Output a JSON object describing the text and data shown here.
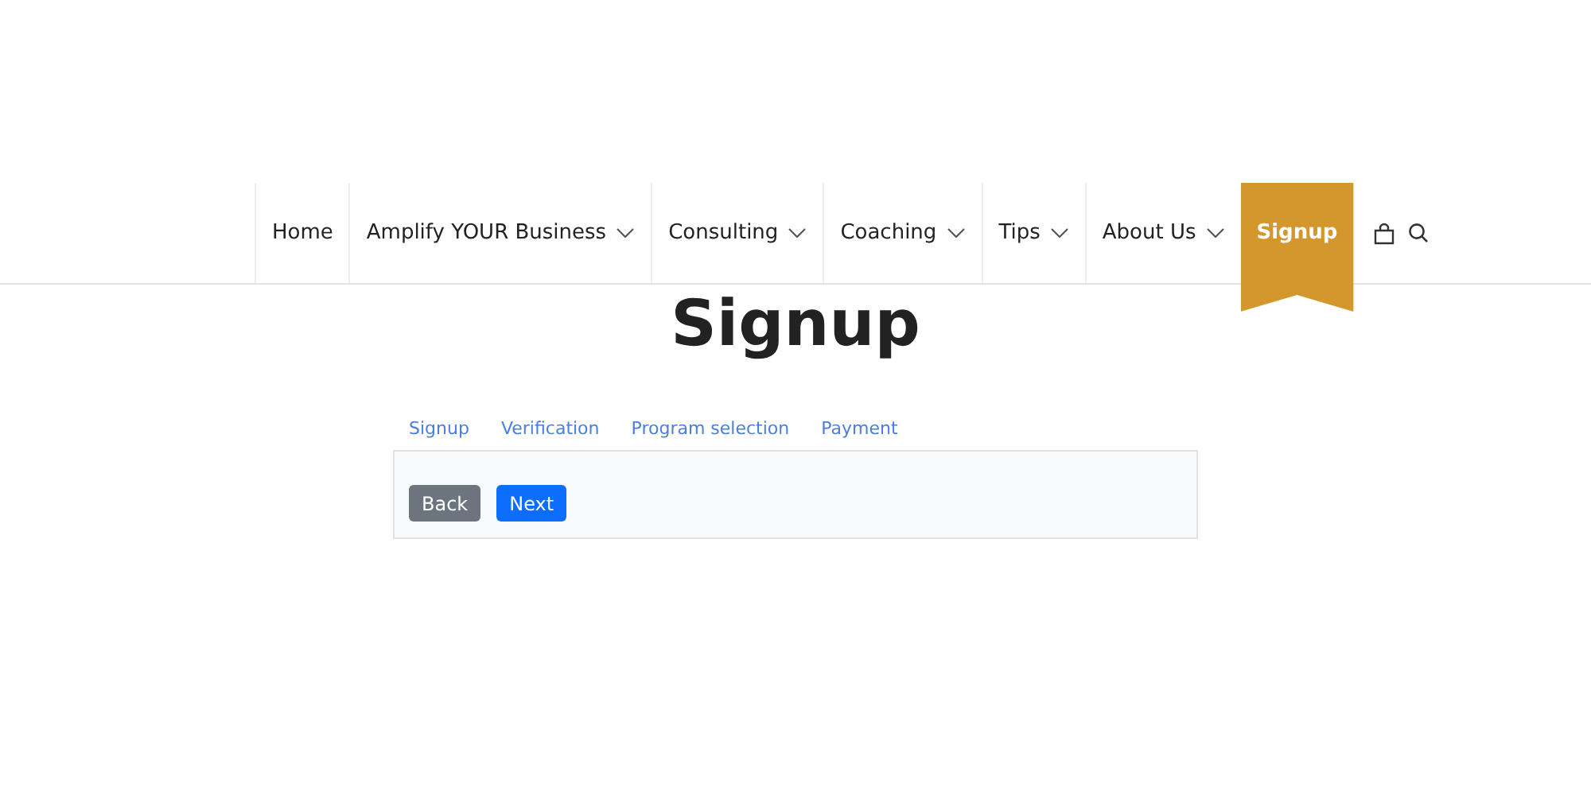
{
  "nav": {
    "items": [
      {
        "label": "Home",
        "dropdown": false,
        "selected": false
      },
      {
        "label": "Amplify YOUR Business",
        "dropdown": true,
        "selected": false
      },
      {
        "label": "Consulting",
        "dropdown": true,
        "selected": false
      },
      {
        "label": "Coaching",
        "dropdown": true,
        "selected": false
      },
      {
        "label": "Tips",
        "dropdown": true,
        "selected": false
      },
      {
        "label": "About Us",
        "dropdown": true,
        "selected": false
      },
      {
        "label": "Signup",
        "dropdown": false,
        "selected": true
      }
    ]
  },
  "title": "Signup",
  "steps": [
    "Signup",
    "Verification",
    "Program selection",
    "Payment"
  ],
  "buttons": [
    {
      "label": "Back",
      "kind": "secondary"
    },
    {
      "label": "Next",
      "kind": "primary"
    }
  ]
}
